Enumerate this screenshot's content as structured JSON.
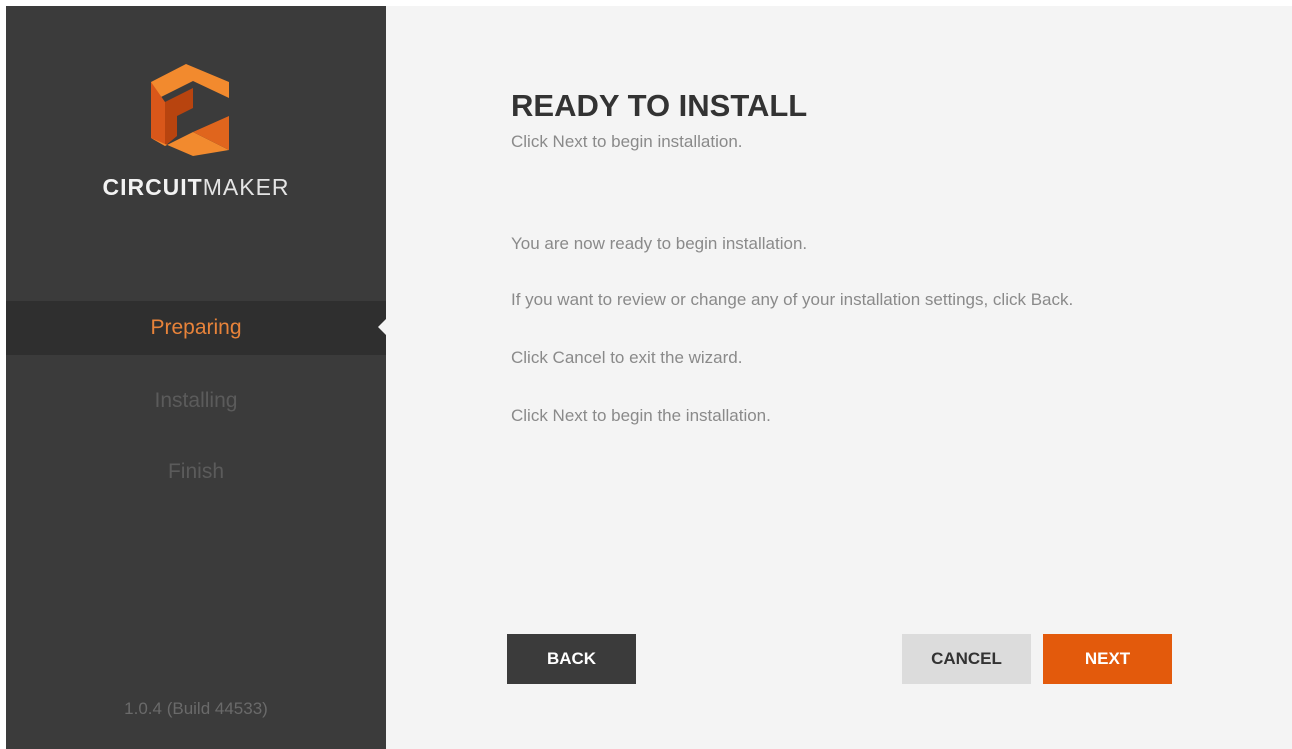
{
  "window": {
    "colors": {
      "sidebar_bg": "#3b3b3b",
      "active_step_bg": "#2f2f2f",
      "active_step_text": "#e8833a",
      "accent_orange": "#e35a0c",
      "content_bg": "#f4f4f4"
    }
  },
  "sidebar": {
    "logo_icon": "circuitmaker-logo-icon",
    "brand": {
      "bold": "CIRCUIT",
      "light": "MAKER"
    },
    "steps": [
      {
        "label": "Preparing",
        "active": true
      },
      {
        "label": "Installing",
        "active": false
      },
      {
        "label": "Finish",
        "active": false
      }
    ],
    "version": "1.0.4 (Build 44533)"
  },
  "main": {
    "title": "READY TO INSTALL",
    "subtitle": "Click Next to begin installation.",
    "paragraphs": [
      "You are now ready to begin installation.",
      "If you want to review or change any of your installation settings, click Back.",
      "Click Cancel to exit the wizard.",
      "Click Next to begin the installation."
    ]
  },
  "buttons": {
    "back": "BACK",
    "cancel": "CANCEL",
    "next": "NEXT"
  }
}
